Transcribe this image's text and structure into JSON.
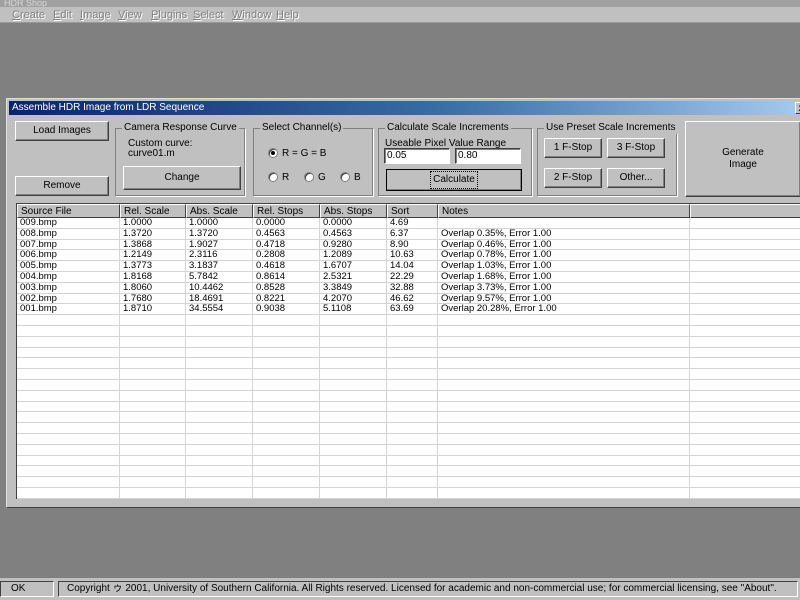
{
  "app": {
    "title": "HDR Shop"
  },
  "menu": [
    "Create",
    "Edit",
    "Image",
    "View",
    "Plugins",
    "Select",
    "Window",
    "Help"
  ],
  "dialog": {
    "title": "Assemble HDR Image from LDR Sequence",
    "close": "x",
    "load_images": "Load Images",
    "remove": "Remove",
    "camera_group": "Camera Response Curve",
    "custom_curve_label": "Custom curve:",
    "custom_curve_value": "curve01.m",
    "change": "Change",
    "channel_group": "Select Channel(s)",
    "channel_options": [
      "R = G = B",
      "R",
      "G",
      "B"
    ],
    "channel_selected": "R = G = B",
    "scale_group": "Calculate Scale Increments",
    "pixel_range_label": "Useable Pixel Value Range",
    "range_min": "0.05",
    "range_max": "0.80",
    "calculate": "Calculate",
    "preset_group": "Use Preset Scale Increments",
    "preset_buttons": [
      "1 F-Stop",
      "3 F-Stop",
      "2 F-Stop",
      "Other..."
    ],
    "generate": "Generate Image"
  },
  "table": {
    "columns": [
      "Source File",
      "Rel. Scale",
      "Abs. Scale",
      "Rel. Stops",
      "Abs. Stops",
      "Sort",
      "Notes"
    ],
    "rows": [
      [
        "009.bmp",
        "1.0000",
        "1.0000",
        "0.0000",
        "0.0000",
        "4.69",
        ""
      ],
      [
        "008.bmp",
        "1.3720",
        "1.3720",
        "0.4563",
        "0.4563",
        "6.37",
        "Overlap 0.35%, Error 1.00"
      ],
      [
        "007.bmp",
        "1.3868",
        "1.9027",
        "0.4718",
        "0.9280",
        "8.90",
        "Overlap 0.46%, Error 1.00"
      ],
      [
        "006.bmp",
        "1.2149",
        "2.3116",
        "0.2808",
        "1.2089",
        "10.63",
        "Overlap 0.78%, Error 1.00"
      ],
      [
        "005.bmp",
        "1.3773",
        "3.1837",
        "0.4618",
        "1.6707",
        "14.04",
        "Overlap 1.03%, Error 1.00"
      ],
      [
        "004.bmp",
        "1.8168",
        "5.7842",
        "0.8614",
        "2.5321",
        "22.29",
        "Overlap 1.68%, Error 1.00"
      ],
      [
        "003.bmp",
        "1.8060",
        "10.4462",
        "0.8528",
        "3.3849",
        "32.88",
        "Overlap 3.73%, Error 1.00"
      ],
      [
        "002.bmp",
        "1.7680",
        "18.4691",
        "0.8221",
        "4.2070",
        "46.62",
        "Overlap 9.57%, Error 1.00"
      ],
      [
        "001.bmp",
        "1.8710",
        "34.5554",
        "0.9038",
        "5.1108",
        "63.69",
        "Overlap 20.28%, Error 1.00"
      ]
    ]
  },
  "status": {
    "ok": "OK",
    "message": "Copyright ゥ 2001, University of Southern California.  All Rights reserved.  Licensed for academic and non-commercial use; for commercial licensing, see \"About\"."
  }
}
